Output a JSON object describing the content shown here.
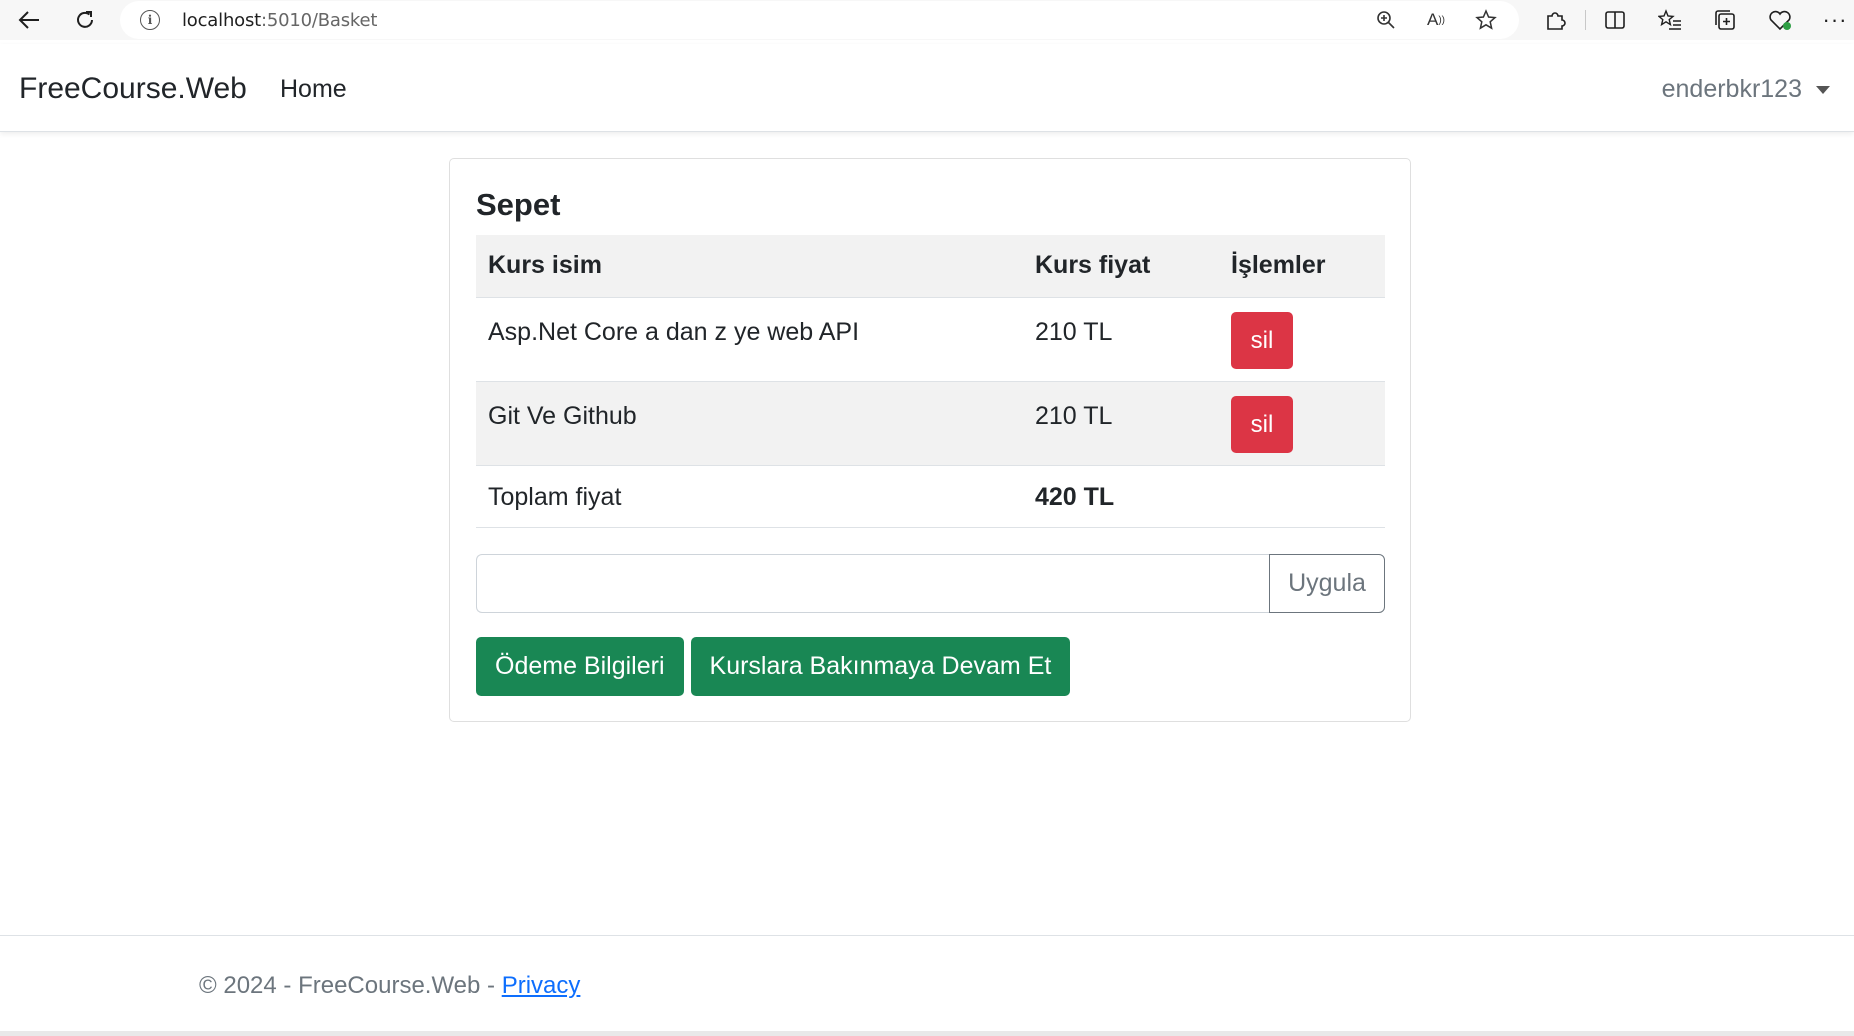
{
  "browser": {
    "url_host": "localhost",
    "url_path": ":5010/Basket"
  },
  "navbar": {
    "brand": "FreeCourse.Web",
    "home_label": "Home",
    "user_name": "enderbkr123"
  },
  "basket": {
    "title": "Sepet",
    "headers": [
      "Kurs isim",
      "Kurs fiyat",
      "İşlemler"
    ],
    "items": [
      {
        "name": "Asp.Net Core a dan z ye web API",
        "price": "210 TL",
        "action": "sil"
      },
      {
        "name": "Git Ve Github",
        "price": "210 TL",
        "action": "sil"
      }
    ],
    "total_label": "Toplam fiyat",
    "total_value": "420 TL",
    "discount_placeholder": "",
    "apply_label": "Uygula",
    "payment_button": "Ödeme Bilgileri",
    "continue_button": "Kurslara Bakınmaya Devam Et"
  },
  "footer": {
    "copyright": "© 2024 - FreeCourse.Web - ",
    "privacy_label": "Privacy"
  },
  "colors": {
    "danger": "#dc3545",
    "success": "#198754",
    "link": "#0d6efd"
  }
}
